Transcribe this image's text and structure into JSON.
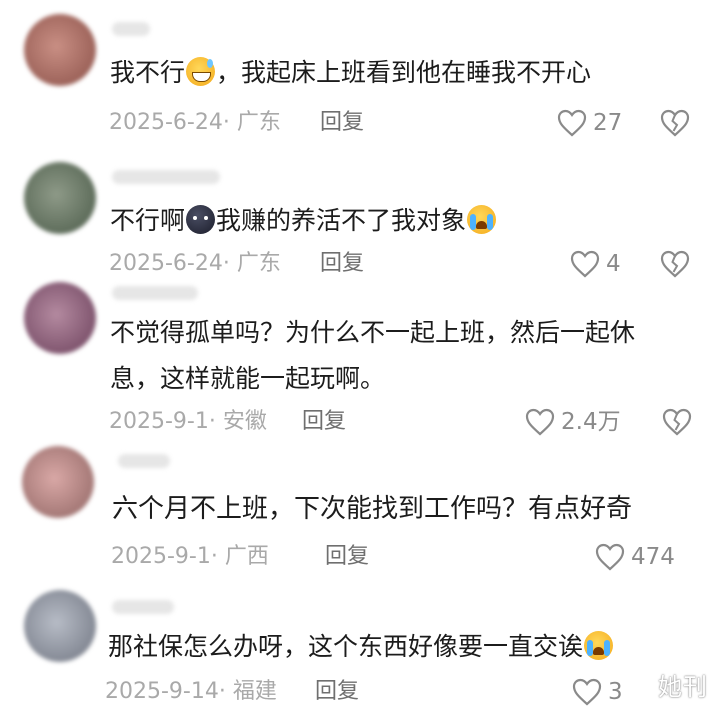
{
  "comments": [
    {
      "text_before": "我不行",
      "emoji": "grin-sweat-emoji",
      "text_after": "，我起床上班看到他在睡我不开心",
      "date_location": "2025-6-24· 广东",
      "reply_label": "回复",
      "likes": "27"
    },
    {
      "text_before": "不行啊",
      "emoji": "dark-face-emoji",
      "text_middle": "我赚的养活不了我对象",
      "emoji2": "crying-face-emoji",
      "date_location": "2025-6-24· 广东",
      "reply_label": "回复",
      "likes": "4"
    },
    {
      "line1": "不觉得孤单吗？为什么不一起上班，然后一起休",
      "line2": "息，这样就能一起玩啊。",
      "date_location": "2025-9-1· 安徽",
      "reply_label": "回复",
      "likes": "2.4万"
    },
    {
      "text": "六个月不上班，下次能找到工作吗？有点好奇",
      "date_location": "2025-9-1· 广西",
      "reply_label": "回复",
      "likes": "474"
    },
    {
      "text_before": "那社保怎么办呀，这个东西好像要一直交诶",
      "emoji": "crying-face-emoji",
      "date_location": "2025-9-14· 福建",
      "reply_label": "回复",
      "likes": "3"
    }
  ],
  "watermark": "她刊",
  "colors": {
    "text": "#1c1c1c",
    "meta": "#a9a9a9",
    "reply": "#6f6f6f",
    "icon": "#8a8a8a"
  },
  "icons": {
    "like": "heart-outline-icon",
    "dislike": "broken-heart-icon"
  }
}
